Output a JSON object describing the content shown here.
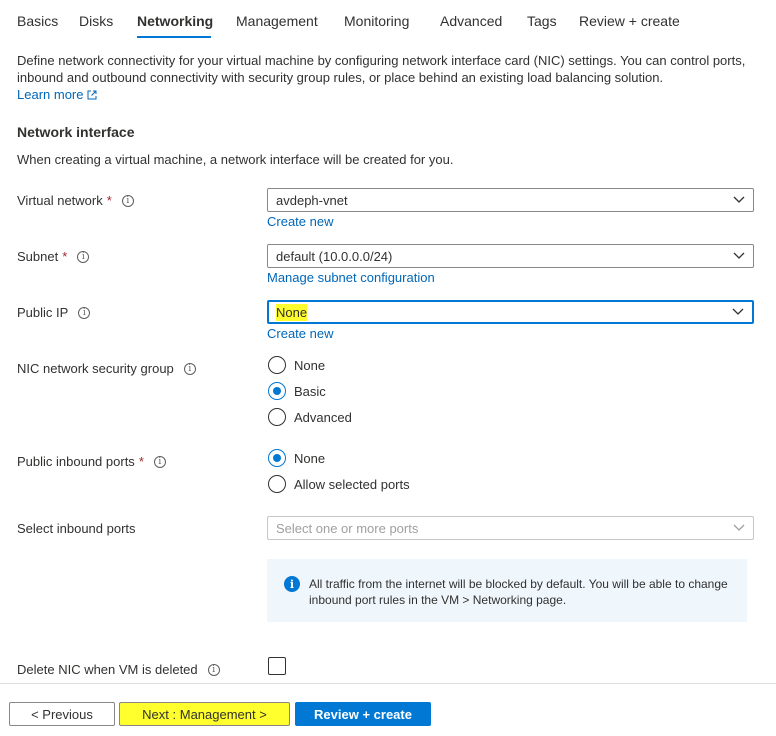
{
  "tabs": [
    {
      "label": "Basics",
      "active": false
    },
    {
      "label": "Disks",
      "active": false
    },
    {
      "label": "Networking",
      "active": true
    },
    {
      "label": "Management",
      "active": false
    },
    {
      "label": "Monitoring",
      "active": false
    },
    {
      "label": "Advanced",
      "active": false
    },
    {
      "label": "Tags",
      "active": false
    },
    {
      "label": "Review + create",
      "active": false
    }
  ],
  "intro": {
    "text": "Define network connectivity for your virtual machine by configuring network interface card (NIC) settings. You can control ports, inbound and outbound connectivity with security group rules, or place behind an existing load balancing solution.",
    "learn_more": "Learn more"
  },
  "network_interface": {
    "title": "Network interface",
    "description": "When creating a virtual machine, a network interface will be created for you."
  },
  "fields": {
    "virtual_network": {
      "label": "Virtual network",
      "required": "*",
      "value": "avdeph-vnet",
      "link": "Create new"
    },
    "subnet": {
      "label": "Subnet",
      "required": "*",
      "value": "default (10.0.0.0/24)",
      "link": "Manage subnet configuration"
    },
    "public_ip": {
      "label": "Public IP",
      "value_highlighted": "None",
      "link": "Create new"
    },
    "nic_nsg": {
      "label": "NIC network security group",
      "options": [
        {
          "label": "None",
          "checked": false
        },
        {
          "label": "Basic",
          "checked": true
        },
        {
          "label": "Advanced",
          "checked": false
        }
      ]
    },
    "public_inbound_ports": {
      "label": "Public inbound ports",
      "required": "*",
      "options": [
        {
          "label": "None",
          "checked": true
        },
        {
          "label": "Allow selected ports",
          "checked": false
        }
      ]
    },
    "select_inbound_ports": {
      "label": "Select inbound ports",
      "placeholder": "Select one or more ports"
    },
    "delete_nic": {
      "label": "Delete NIC when VM is deleted",
      "checked": false
    }
  },
  "infobox": {
    "text": "All traffic from the internet will be blocked by default. You will be able to change inbound port rules in the VM > Networking page."
  },
  "footer": {
    "previous": "< Previous",
    "next": "Next : Management >",
    "review": "Review + create"
  },
  "colors": {
    "accent": "#0078d4",
    "link": "#0067b8",
    "highlight": "#ffff2e",
    "required": "#a4262c"
  },
  "icons": {
    "info": "info-icon",
    "external_link": "external-link-icon",
    "chevron": "chevron-down-icon"
  }
}
